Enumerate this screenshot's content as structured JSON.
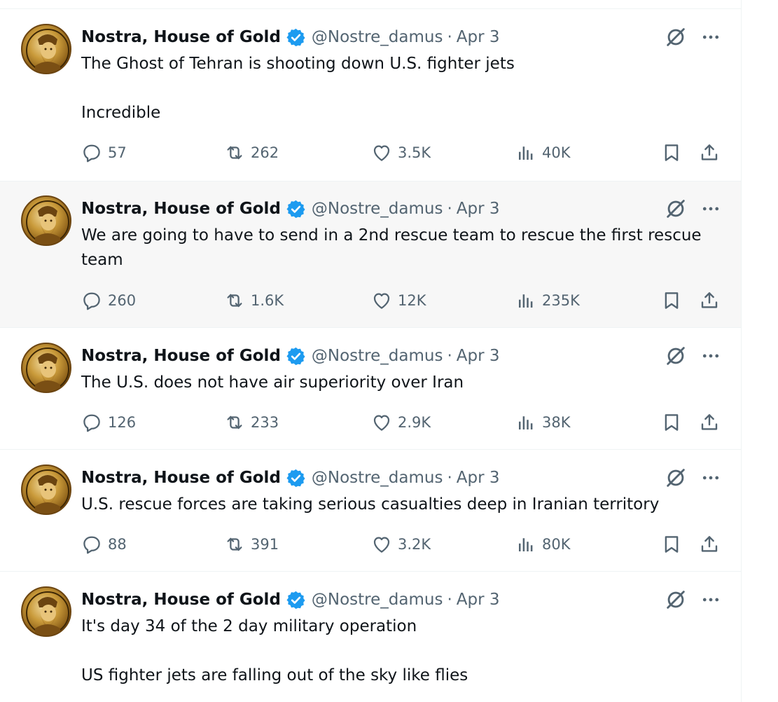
{
  "tweets": [
    {
      "author": "Nostra, House of Gold",
      "handle": "@Nostre_damus",
      "separator": "·",
      "date": "Apr 3",
      "text": [
        "The Ghost of Tehran is shooting down U.S. fighter jets",
        "",
        "Incredible"
      ],
      "stats": {
        "replies": "57",
        "reposts": "262",
        "likes": "3.5K",
        "views": "40K"
      },
      "highlighted": false
    },
    {
      "author": "Nostra, House of Gold",
      "handle": "@Nostre_damus",
      "separator": "·",
      "date": "Apr 3",
      "text": [
        "We are going to have to send in a 2nd rescue team to rescue the first rescue team"
      ],
      "stats": {
        "replies": "260",
        "reposts": "1.6K",
        "likes": "12K",
        "views": "235K"
      },
      "highlighted": true
    },
    {
      "author": "Nostra, House of Gold",
      "handle": "@Nostre_damus",
      "separator": "·",
      "date": "Apr 3",
      "text": [
        "The U.S. does not have air superiority over Iran"
      ],
      "stats": {
        "replies": "126",
        "reposts": "233",
        "likes": "2.9K",
        "views": "38K"
      },
      "highlighted": false
    },
    {
      "author": "Nostra, House of Gold",
      "handle": "@Nostre_damus",
      "separator": "·",
      "date": "Apr 3",
      "text": [
        "U.S. rescue forces are taking serious casualties deep in Iranian territory"
      ],
      "stats": {
        "replies": "88",
        "reposts": "391",
        "likes": "3.2K",
        "views": "80K"
      },
      "highlighted": false
    },
    {
      "author": "Nostra, House of Gold",
      "handle": "@Nostre_damus",
      "separator": "·",
      "date": "Apr 3",
      "text": [
        "It's day 34 of the 2 day military operation",
        "",
        "US fighter jets are falling out of the sky like flies"
      ],
      "highlighted": false
    }
  ],
  "colors": {
    "text": "#0f1419",
    "secondary": "#536471",
    "verified": "#1d9bf0",
    "highlight_bg": "#f7f7f7",
    "divider": "#eff3f4"
  },
  "icons": {
    "verified": "verified-badge-icon",
    "grok": "grok-icon",
    "more": "more-icon",
    "reply": "reply-icon",
    "repost": "repost-icon",
    "like": "like-icon",
    "views": "views-icon",
    "bookmark": "bookmark-icon",
    "share": "share-icon"
  }
}
